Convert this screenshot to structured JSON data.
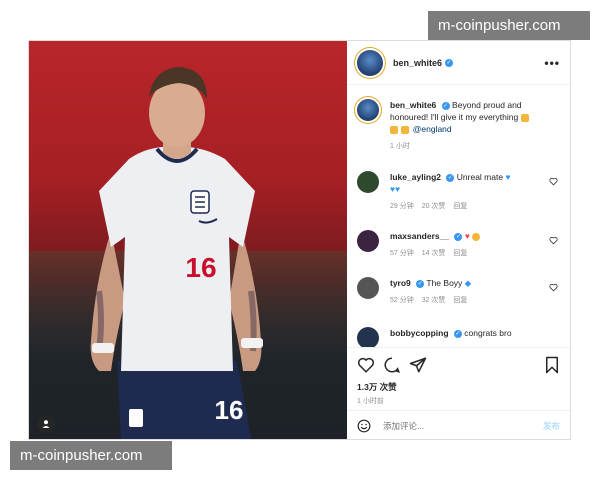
{
  "watermark_top": "m-coinpusher.com",
  "watermark_bottom": "m-coinpusher.com",
  "header": {
    "username": "ben_white6",
    "more": "•••"
  },
  "caption": {
    "username": "ben_white6",
    "text": "Beyond proud and honoured! I'll give it my everything",
    "mention": "@england",
    "time": "1 小时"
  },
  "comments": [
    {
      "username": "luke_ayling2",
      "text": "Unreal mate",
      "time": "29 分钟",
      "likes": "20 次赞",
      "reply": "回复"
    },
    {
      "username": "maxsanders__",
      "text": "",
      "time": "57 分钟",
      "likes": "14 次赞",
      "reply": "回复"
    },
    {
      "username": "tyro9",
      "text": "The Boyy",
      "time": "52 分钟",
      "likes": "32 次赞",
      "reply": "回复"
    },
    {
      "username": "bobbycopping",
      "text": "congrats bro",
      "time": "",
      "likes": "",
      "reply": ""
    }
  ],
  "likes_count": "1.3万 次赞",
  "post_time": "1 小时前",
  "add_comment": {
    "placeholder": "添加评论...",
    "post_label": "发布"
  },
  "jersey_number": "16",
  "colors": {
    "verified": "#3897f0",
    "link": "#00376b",
    "heart": "#ed4956"
  }
}
